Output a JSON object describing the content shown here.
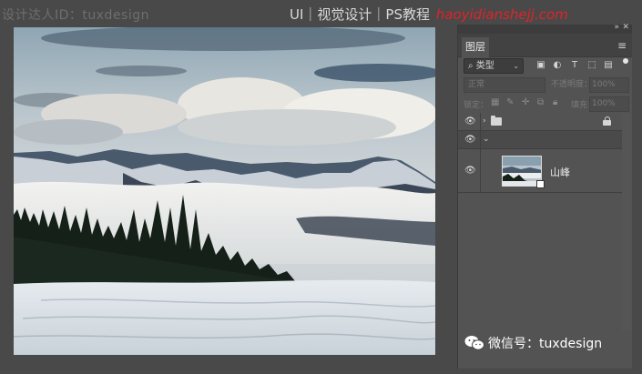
{
  "watermark": {
    "left_text": "设计达人ID：tuxdesign",
    "right_prefix": "UI｜视觉设计｜PS教程",
    "right_url": "haoyidianshejj.com"
  },
  "canvas": {
    "image": "mountain-landscape"
  },
  "layers_panel": {
    "tab_label": "图层",
    "filter_kind": "类型",
    "blend_mode": "正常",
    "opacity_label": "不透明度：",
    "opacity_value": "100%",
    "lock_label": "锁定：",
    "fill_label": "填充：",
    "fill_value": "100%",
    "layers": [
      {
        "type": "group",
        "name": "",
        "locked": true,
        "visible": true,
        "collapsed": true
      },
      {
        "type": "group",
        "name": "",
        "locked": false,
        "visible": true,
        "collapsed": false
      },
      {
        "type": "smart-object",
        "name": "山峰",
        "visible": true
      }
    ]
  },
  "wechat": {
    "label": "微信号：tuxdesign"
  },
  "icons": [
    "eye-icon",
    "folder-icon",
    "lock-icon",
    "smart-object-icon",
    "panel-menu-icon",
    "close-icon"
  ]
}
